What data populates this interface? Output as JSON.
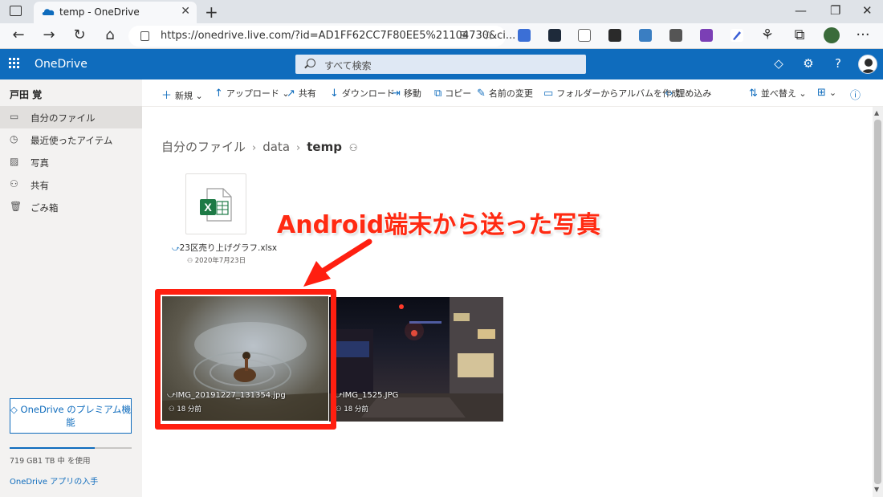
{
  "browser": {
    "tab_title": "temp - OneDrive",
    "tab_close": "✕",
    "new_tab": "+",
    "url": "https://onedrive.live.com/?id=AD1FF62CC7F80EE5%21104730&ci...",
    "win_min": "—",
    "win_max": "❐",
    "win_close": "✕",
    "more": "···"
  },
  "header": {
    "brand": "OneDrive",
    "search_placeholder": "すべて検索",
    "premium_icon": "◇",
    "settings_icon": "⚙",
    "help_icon": "?"
  },
  "sidebar": {
    "user": "戸田 覚",
    "items": [
      {
        "label": "自分のファイル",
        "icon": "folder-icon",
        "active": true
      },
      {
        "label": "最近使ったアイテム",
        "icon": "clock-icon",
        "active": false
      },
      {
        "label": "写真",
        "icon": "photo-icon",
        "active": false
      },
      {
        "label": "共有",
        "icon": "people-icon",
        "active": false
      },
      {
        "label": "ごみ箱",
        "icon": "trash-icon",
        "active": false
      }
    ],
    "premium_label": "OneDrive のプレミアム機能",
    "storage_text": "719 GB1 TB 中 を使用",
    "storage_fraction": 0.7,
    "app_link": "OneDrive アプリの入手"
  },
  "commands": {
    "new": "新規",
    "upload": "アップロード",
    "share": "共有",
    "download": "ダウンロード",
    "move": "移動",
    "copy": "コピー",
    "rename": "名前の変更",
    "album": "フォルダーからアルバムを作成",
    "embed": "埋め込み",
    "sort": "並べ替え"
  },
  "breadcrumb": {
    "root": "自分のファイル",
    "mid": "data",
    "current": "temp"
  },
  "files": [
    {
      "name": "23区売り上げグラフ.xlsx",
      "date": "2020年7月23日",
      "type": "excel"
    },
    {
      "name": "IMG_20191227_131354.jpg",
      "time": "18 分前",
      "type": "photo"
    },
    {
      "name": "IMG_1525.JPG",
      "time": "18 分前",
      "type": "photo"
    }
  ],
  "annotation": "Android端末から送った写真",
  "colors": {
    "brand_blue": "#0f6cbd",
    "annotation_red": "#ff1f10",
    "excel_green": "#1d7a45"
  }
}
